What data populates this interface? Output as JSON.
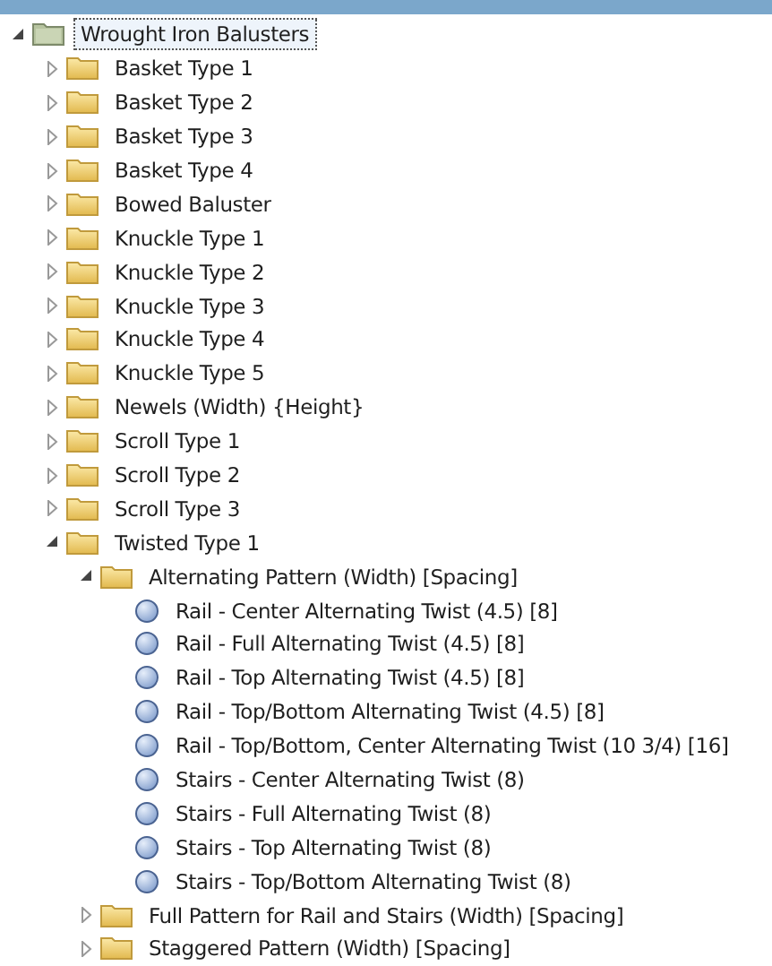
{
  "tree": [
    {
      "label": "Wrought Iron Balusters",
      "kind": "root",
      "expanded": true,
      "selected": true,
      "children": [
        {
          "label": "Basket Type 1",
          "kind": "folder",
          "expanded": false,
          "selected": false
        },
        {
          "label": "Basket Type 2",
          "kind": "folder",
          "expanded": false,
          "selected": false
        },
        {
          "label": "Basket Type 3",
          "kind": "folder",
          "expanded": false,
          "selected": false
        },
        {
          "label": "Basket Type 4",
          "kind": "folder",
          "expanded": false,
          "selected": false
        },
        {
          "label": "Bowed Baluster",
          "kind": "folder",
          "expanded": false,
          "selected": false
        },
        {
          "label": "Knuckle Type 1",
          "kind": "folder",
          "expanded": false,
          "selected": false
        },
        {
          "label": "Knuckle Type 2",
          "kind": "folder",
          "expanded": false,
          "selected": false
        },
        {
          "label": "Knuckle Type 3",
          "kind": "folder",
          "expanded": false,
          "selected": false
        },
        {
          "label": "Knuckle Type 4",
          "kind": "folder",
          "expanded": false,
          "selected": false
        },
        {
          "label": "Knuckle Type 5",
          "kind": "folder",
          "expanded": false,
          "selected": false
        },
        {
          "label": "Newels (Width) {Height}",
          "kind": "folder",
          "expanded": false,
          "selected": false
        },
        {
          "label": "Scroll Type 1",
          "kind": "folder",
          "expanded": false,
          "selected": false
        },
        {
          "label": "Scroll Type 2",
          "kind": "folder",
          "expanded": false,
          "selected": false
        },
        {
          "label": "Scroll Type 3",
          "kind": "folder",
          "expanded": false,
          "selected": false
        },
        {
          "label": "Twisted Type 1",
          "kind": "folder",
          "expanded": true,
          "selected": false,
          "children": [
            {
              "label": "Alternating Pattern (Width) [Spacing]",
              "kind": "folder",
              "expanded": true,
              "selected": false,
              "children": [
                {
                  "label": "Rail - Center Alternating Twist (4.5) [8]",
                  "kind": "item",
                  "selected": false
                },
                {
                  "label": "Rail - Full Alternating Twist (4.5) [8]",
                  "kind": "item",
                  "selected": false
                },
                {
                  "label": "Rail - Top Alternating Twist (4.5) [8]",
                  "kind": "item",
                  "selected": false
                },
                {
                  "label": "Rail - Top/Bottom Alternating Twist (4.5) [8]",
                  "kind": "item",
                  "selected": false
                },
                {
                  "label": "Rail - Top/Bottom, Center Alternating Twist (10 3/4) [16]",
                  "kind": "item",
                  "selected": false
                },
                {
                  "label": "Stairs - Center Alternating Twist (8)",
                  "kind": "item",
                  "selected": false
                },
                {
                  "label": "Stairs - Full Alternating Twist (8)",
                  "kind": "item",
                  "selected": false
                },
                {
                  "label": "Stairs - Top Alternating Twist (8)",
                  "kind": "item",
                  "selected": false
                },
                {
                  "label": "Stairs - Top/Bottom Alternating Twist (8)",
                  "kind": "item",
                  "selected": false
                }
              ]
            },
            {
              "label": "Full Pattern for Rail and Stairs (Width) [Spacing]",
              "kind": "folder",
              "expanded": false,
              "selected": false
            },
            {
              "label": "Staggered Pattern (Width) [Spacing]",
              "kind": "folder",
              "expanded": false,
              "selected": false
            }
          ]
        }
      ]
    }
  ]
}
